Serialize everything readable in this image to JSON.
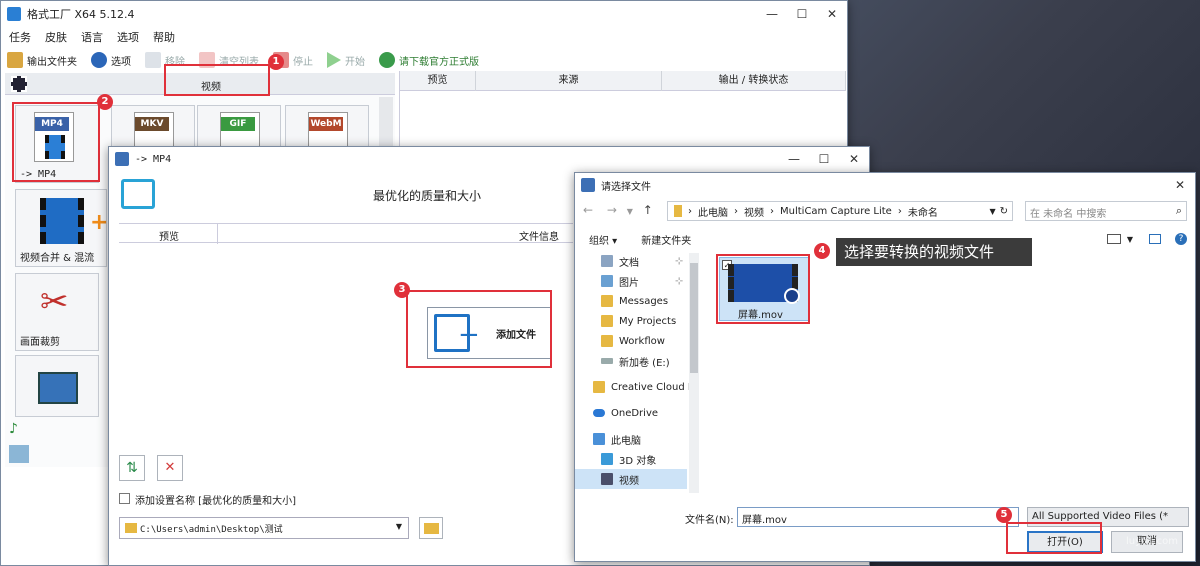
{
  "main_window": {
    "title": "格式工厂 X64 5.12.4",
    "menu": [
      "任务",
      "皮肤",
      "语言",
      "选项",
      "帮助"
    ],
    "toolbar": {
      "output_folder": "输出文件夹",
      "options": "选项",
      "remove": "移除",
      "clear_list": "清空列表",
      "stop": "停止",
      "start": "开始",
      "download": "请下载官方正式版"
    },
    "category_video": "视频",
    "formats": [
      {
        "tag": "MP4",
        "label": "-> MP4"
      },
      {
        "tag": "MKV",
        "label": ""
      },
      {
        "tag": "GIF",
        "label": ""
      },
      {
        "tag": "WebM",
        "label": ""
      }
    ],
    "tools": [
      "视频合并 & 混流",
      "画面裁剪"
    ],
    "table_headers": [
      "预览",
      "来源",
      "输出 / 转换状态"
    ]
  },
  "mp4_dialog": {
    "title": "-> MP4",
    "quality": "最优化的质量和大小",
    "headers": [
      "预览",
      "文件信息"
    ],
    "add_file": "添加文件",
    "save_setting_label": "添加设置名称 [最优化的质量和大小]",
    "output_path": "C:\\Users\\admin\\Desktop\\测试"
  },
  "file_dialog": {
    "title": "请选择文件",
    "breadcrumb": [
      "此电脑",
      "视频",
      "MultiCam Capture Lite",
      "未命名"
    ],
    "search_placeholder": "在 未命名 中搜索",
    "organize": "组织",
    "new_folder": "新建文件夹",
    "nav_items": [
      "文档",
      "图片",
      "Messages",
      "My Projects",
      "Workflow",
      "新加卷 (E:)",
      "Creative Cloud F",
      "OneDrive",
      "此电脑",
      "3D 对象",
      "视频"
    ],
    "file_name": "屏幕.mov",
    "filename_label": "文件名(N):",
    "filename_value": "屏幕.mov",
    "filter": "All Supported Video Files (*",
    "open": "打开(O)",
    "cancel": "取消"
  },
  "annotations": {
    "badges": [
      "1",
      "2",
      "3",
      "4",
      "5"
    ],
    "callout": "选择要转换的视频文件"
  },
  "watermark": "luyou.com"
}
